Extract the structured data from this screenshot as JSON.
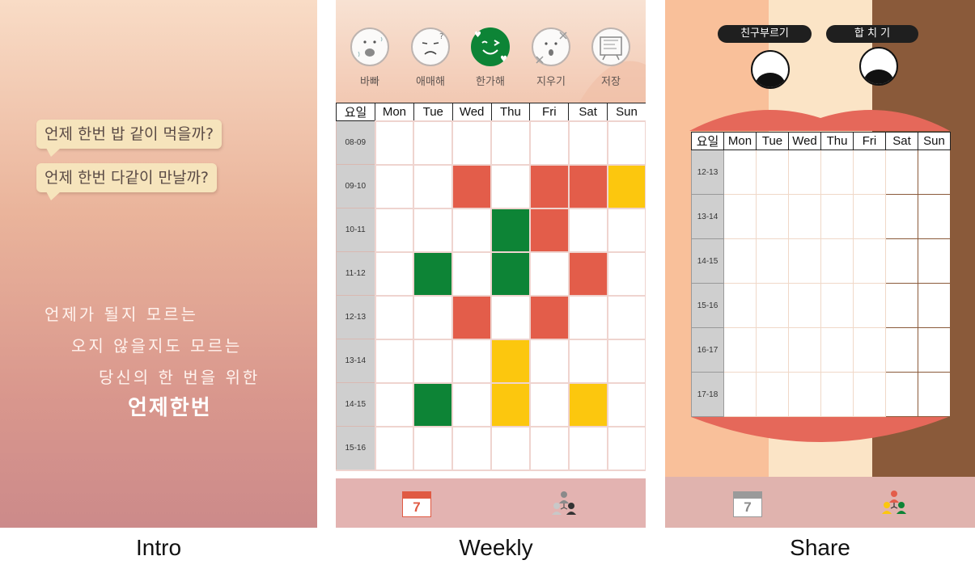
{
  "intro": {
    "bubbles": [
      "언제 한번 밥 같이 먹을까?",
      "언제 한번 다같이 만날까?"
    ],
    "poem": [
      "언제가 될지 모르는",
      "오지 않을지도 모르는",
      "당신의 한 번을 위한"
    ],
    "title": "언제한번",
    "caption": "Intro"
  },
  "weekly": {
    "moods": [
      {
        "label": "바빠",
        "icon": "busy-face-icon"
      },
      {
        "label": "애매해",
        "icon": "unsure-face-icon"
      },
      {
        "label": "한가해",
        "icon": "free-face-icon"
      },
      {
        "label": "지우기",
        "icon": "erase-face-icon"
      },
      {
        "label": "저장",
        "icon": "save-icon"
      }
    ],
    "header": [
      "요일",
      "Mon",
      "Tue",
      "Wed",
      "Thu",
      "Fri",
      "Sat",
      "Sun"
    ],
    "slots": [
      "08-09",
      "09-10",
      "10-11",
      "11-12",
      "12-13",
      "13-14",
      "14-15",
      "15-16"
    ],
    "schedule": [
      [
        "",
        "",
        "",
        "",
        "",
        "",
        ""
      ],
      [
        "",
        "",
        "busy",
        "",
        "busy",
        "busy",
        "maybe"
      ],
      [
        "",
        "",
        "",
        "free",
        "busy",
        "",
        ""
      ],
      [
        "",
        "free",
        "",
        "free",
        "",
        "busy",
        ""
      ],
      [
        "",
        "",
        "busy",
        "",
        "busy",
        "",
        ""
      ],
      [
        "",
        "",
        "",
        "maybe",
        "",
        "",
        ""
      ],
      [
        "",
        "free",
        "",
        "maybe",
        "",
        "maybe",
        ""
      ],
      [
        "",
        "",
        "",
        "",
        "",
        "",
        ""
      ]
    ],
    "nav": {
      "calendar_day": "7",
      "calendar_icon": "calendar-icon",
      "group_icon": "group-icon"
    },
    "caption": "Weekly"
  },
  "share": {
    "buttons": [
      "친구부르기",
      "합 치 기"
    ],
    "header": [
      "요일",
      "Mon",
      "Tue",
      "Wed",
      "Thu",
      "Fri",
      "Sat",
      "Sun"
    ],
    "slots": [
      "12-13",
      "13-14",
      "14-15",
      "15-16",
      "16-17",
      "17-18"
    ],
    "nav": {
      "calendar_day": "7",
      "calendar_icon": "calendar-icon",
      "group_icon": "group-icon"
    },
    "caption": "Share"
  },
  "colors": {
    "busy": "#e35d4a",
    "free": "#0d8436",
    "maybe": "#fcc70e",
    "share_left": "#f9c09a",
    "share_mid": "#fbe4c6",
    "share_right": "#8a5a3a",
    "lips": "#e5685a"
  }
}
